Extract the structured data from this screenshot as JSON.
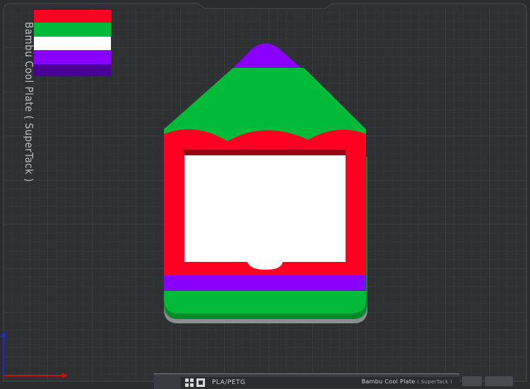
{
  "plate": {
    "vertical_label": "Bambu Cool Plate ( SuperTack )"
  },
  "statusbar": {
    "filament_label": "PLA/PETG",
    "plate_name": "Bambu Cool Plate",
    "plate_type": "( SuperTack )"
  },
  "colors": {
    "background": "#2b2c30",
    "grid": "#3a3b40",
    "red": "#ff0022",
    "green": "#00bb3a",
    "purple": "#8a00ff",
    "white": "#ffffff",
    "axis_x": "#cc1111",
    "axis_y": "#1a2bd8"
  },
  "icons": [
    "layout-icon",
    "view-icon"
  ]
}
